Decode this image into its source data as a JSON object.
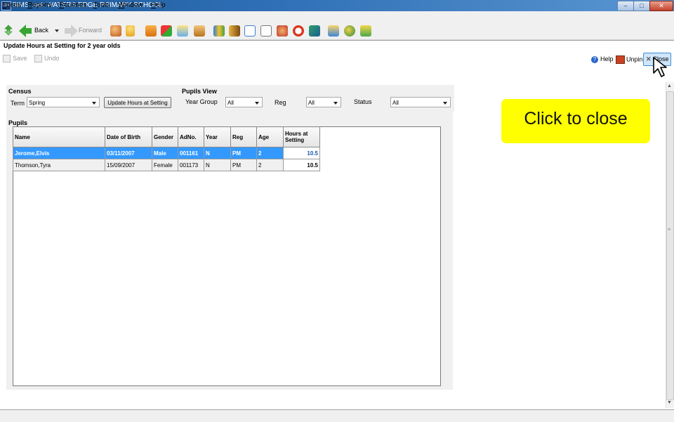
{
  "window": {
    "app_icon_text": "SIMS",
    "title": "SIMS .net: WATERS EDGE PRIMARY SCHOOL",
    "controls": {
      "minimize": "–",
      "maximize": "□",
      "close": "✕"
    }
  },
  "menu": [
    {
      "first": "F",
      "rest": "ocus"
    },
    {
      "first": "R",
      "rest": "eports"
    },
    {
      "first": "R",
      "rest": "outines"
    },
    {
      "first": "T",
      "rest": "ools"
    },
    {
      "first": "W",
      "rest": "indow"
    },
    {
      "first": "H",
      "rest": "elp"
    }
  ],
  "toolbar": {
    "back_label": "Back",
    "forward_label": "Forward",
    "icons": [
      "people-icon",
      "person-icon",
      "book-icon",
      "flag-icon",
      "folder-icon",
      "person-card-icon",
      "books-icon",
      "notebook-icon",
      "document-icon",
      "edit-icon",
      "group-icon",
      "clock-icon",
      "cube-icon",
      "export-icon",
      "globe-icon",
      "report-icon"
    ]
  },
  "page": {
    "title": "Update Hours at Setting for 2 year olds",
    "save_label": "Save",
    "undo_label": "Undo",
    "help_label": "Help",
    "unpin_label": "Unpin",
    "close_label": "Close"
  },
  "census": {
    "title": "Census",
    "term_label": "Term",
    "term_value": "Spring",
    "update_button": "Update Hours at Setting"
  },
  "pupils_view": {
    "title": "Pupils View",
    "year_group_label": "Year Group",
    "year_group_value": "All",
    "reg_label": "Reg",
    "reg_value": "All",
    "status_label": "Status",
    "status_value": "All"
  },
  "pupils": {
    "title": "Pupils",
    "columns": [
      "Name",
      "Date of Birth",
      "Gender",
      "AdNo.",
      "Year",
      "Reg",
      "Age",
      "Hours at Setting"
    ],
    "rows": [
      [
        "Jerome,Elvis",
        "03/11/2007",
        "Male",
        "001161",
        "N",
        "PM",
        "2",
        "10.5"
      ],
      [
        "Thomson,Tyra",
        "15/09/2007",
        "Female",
        "001173",
        "N",
        "PM",
        "2",
        "10.5"
      ]
    ],
    "selected_row": 0
  },
  "callout": {
    "text": "Click to close"
  }
}
